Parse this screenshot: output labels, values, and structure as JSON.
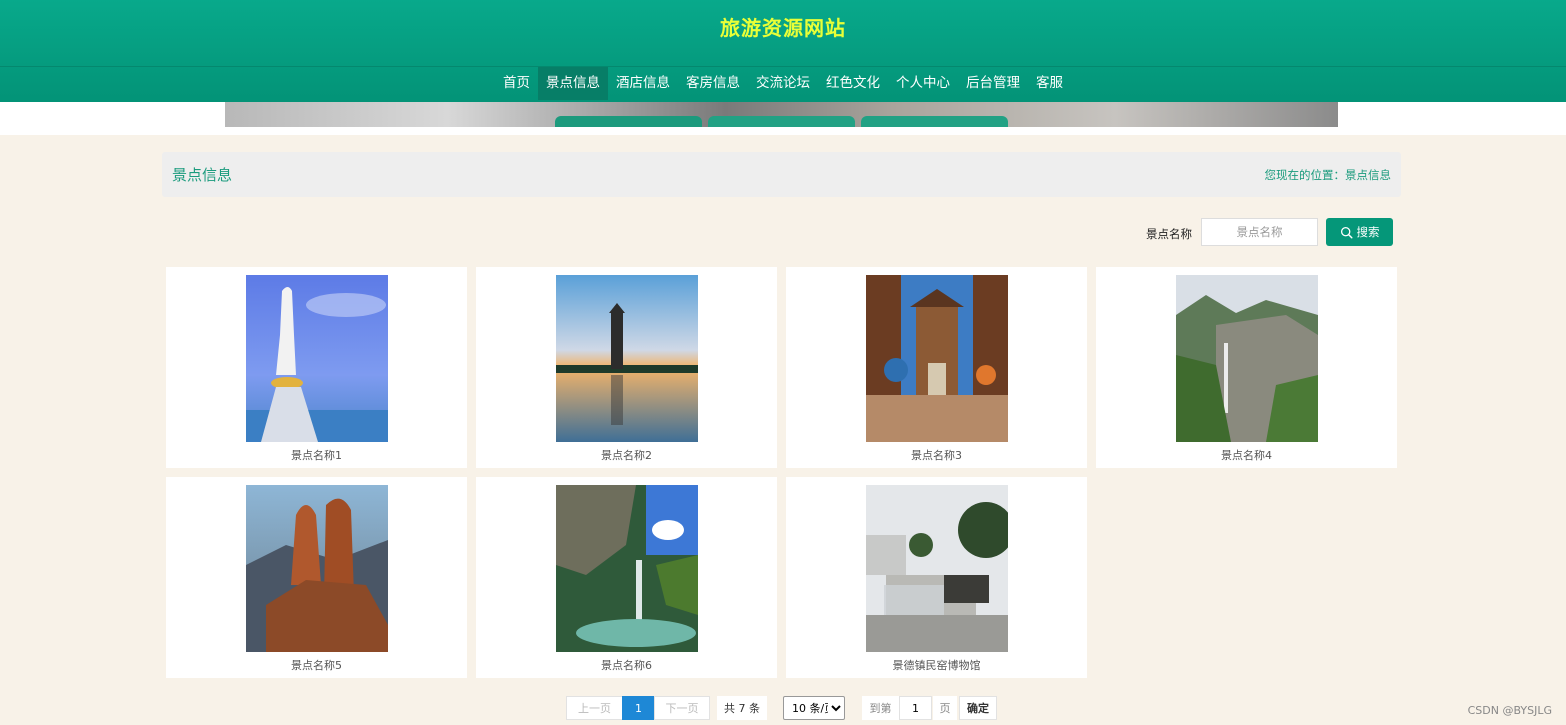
{
  "site": {
    "title": "旅游资源网站"
  },
  "nav": {
    "items": [
      {
        "label": "首页"
      },
      {
        "label": "景点信息",
        "active": true
      },
      {
        "label": "酒店信息"
      },
      {
        "label": "客房信息"
      },
      {
        "label": "交流论坛"
      },
      {
        "label": "红色文化"
      },
      {
        "label": "个人中心"
      },
      {
        "label": "后台管理"
      },
      {
        "label": "客服"
      }
    ]
  },
  "page": {
    "title": "景点信息",
    "location_prefix": "您现在的位置：",
    "location": "景点信息"
  },
  "search": {
    "label": "景点名称",
    "placeholder": "景点名称",
    "button_label": "搜索",
    "icon": "search-icon"
  },
  "cards": [
    {
      "name": "景点名称1"
    },
    {
      "name": "景点名称2"
    },
    {
      "name": "景点名称3"
    },
    {
      "name": "景点名称4"
    },
    {
      "name": "景点名称5"
    },
    {
      "name": "景点名称6"
    },
    {
      "name": "景德镇民窑博物馆"
    }
  ],
  "pagination": {
    "prev": "上一页",
    "current": "1",
    "next": "下一页",
    "total": "共 7 条",
    "page_size": "10 条/页",
    "goto_prefix": "到第",
    "goto_value": "1",
    "goto_suffix": "页",
    "confirm": "确定"
  },
  "watermark": "CSDN @BYSJLG",
  "colors": {
    "header": "#039377",
    "accent": "#1a9b7d",
    "title_yellow": "#e9ff37",
    "pager_active": "#1e88d6"
  }
}
